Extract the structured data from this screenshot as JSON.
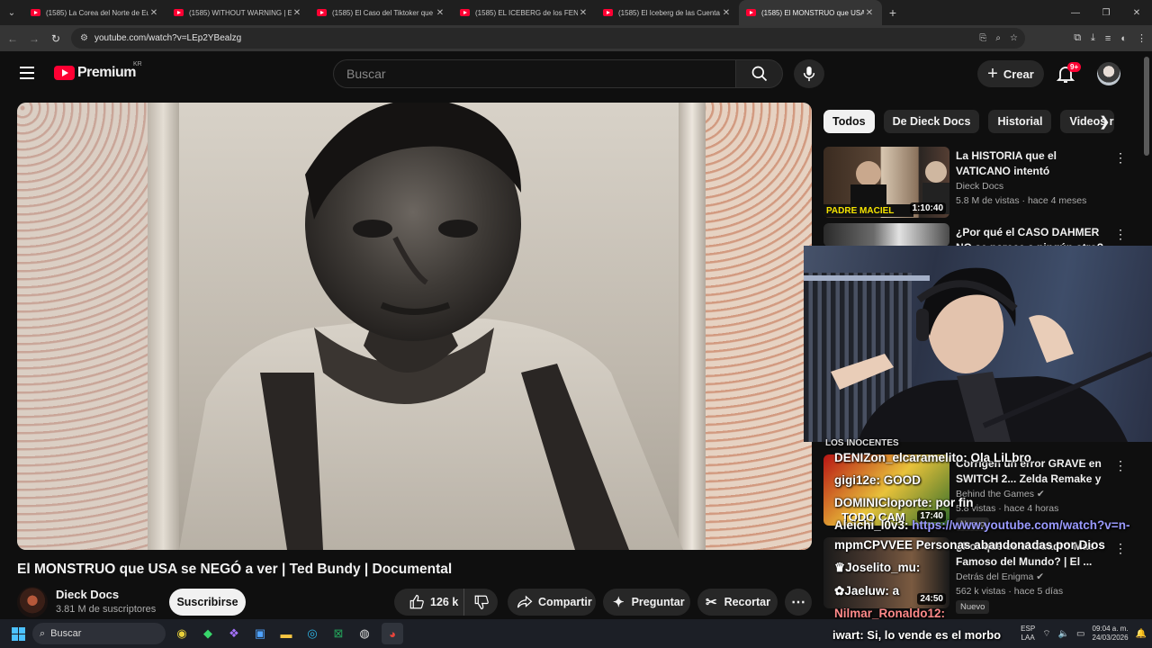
{
  "browser": {
    "tabs": [
      {
        "title": "(1585) La Corea del Norte de Eu",
        "active": false
      },
      {
        "title": "(1585) WITHOUT WARNING | El",
        "active": false
      },
      {
        "title": "(1585) El Caso del Tiktoker que",
        "active": false
      },
      {
        "title": "(1585) EL ICEBERG de los FENÓ",
        "active": false
      },
      {
        "title": "(1585) El Iceberg de las Cuenta",
        "active": false
      },
      {
        "title": "(1585) El MONSTRUO que USA",
        "active": true
      }
    ],
    "url": "youtube.com/watch?v=LEp2YBealzg"
  },
  "youtube": {
    "logo_text": "Premium",
    "country_code": "KR",
    "search_placeholder": "Buscar",
    "create_label": "Crear",
    "notifications_badge": "9+"
  },
  "video": {
    "title": "El MONSTRUO que USA se NEGÓ a ver | Ted Bundy | Documental",
    "channel_name": "Dieck Docs",
    "subscribers": "3.81 M de suscriptores",
    "subscribe_label": "Suscribirse",
    "likes": "126 k",
    "share_label": "Compartir",
    "ask_label": "Preguntar",
    "clip_label": "Recortar"
  },
  "chips": [
    "Todos",
    "De Dieck Docs",
    "Historial",
    "Videos re"
  ],
  "recommendations": [
    {
      "title": "La HISTORIA que el VATICANO intentó ENTERRAR | Padre ...",
      "channel": "Dieck Docs",
      "meta": "5.8 M de vistas · hace 4 meses",
      "duration": "1:10:40",
      "thumb_caption": "PADRE MACIEL",
      "verified": false,
      "badge": ""
    },
    {
      "title": "¿Por qué el CASO DAHMER NO se parece a ningún otro? | ...",
      "channel": "",
      "meta": "",
      "duration": "",
      "thumb_caption": "",
      "verified": false,
      "badge": ""
    },
    {
      "title": "Corrigen un error GRAVE en SWITCH 2... Zelda Remake y ...",
      "channel": "Behind the Games",
      "meta": "5.8 vistas · hace 4 horas",
      "duration": "17:40",
      "thumb_caption": "TODO CAM",
      "verified": true,
      "badge": "Nuevo"
    },
    {
      "title": "¿Por qué es el Cuadro Más Famoso del Mundo? | El ...",
      "channel": "Detrás del Enigma",
      "meta": "562 k vistas · hace 5 días",
      "duration": "24:50",
      "thumb_caption": "",
      "verified": true,
      "badge": "Nuevo"
    }
  ],
  "chat_overlay": [
    {
      "user": "",
      "text": "LOS INOCENTES"
    },
    {
      "user": "DENIZon_elcaramelito",
      "text": ": Ola LiLbro"
    },
    {
      "user": "gigi12e",
      "text": ": GOOD"
    },
    {
      "user": "DOMINICloporte",
      "text": ": por fin"
    },
    {
      "user": "Aleichi_l0v3",
      "text": ": ",
      "link": "https://www.youtube.com/watch?v=n-"
    },
    {
      "user": "",
      "text": "mpmCPVVEE Personas abandonadas por Dios"
    },
    {
      "user": "Joselito_mu",
      "text": ":"
    },
    {
      "user": "Jaeluw",
      "text": ": a"
    },
    {
      "user": "Nilmar_Ronaldo12",
      "text": ":"
    },
    {
      "user": "iwart",
      "text": ": Si, lo vende es el morbo"
    }
  ],
  "taskbar": {
    "search_label": "Buscar",
    "lang": "ESP",
    "layout": "LAA",
    "time": "09:04 a. m.",
    "date": "24/03/2026"
  }
}
